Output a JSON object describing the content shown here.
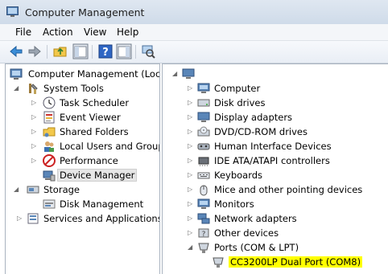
{
  "window": {
    "title": "Computer Management"
  },
  "menu": [
    {
      "label": "File"
    },
    {
      "label": "Action"
    },
    {
      "label": "View"
    },
    {
      "label": "Help"
    }
  ],
  "toolbar": [
    "back-arrow-icon",
    "forward-arrow-icon",
    "up-folder-icon",
    "show-hide-tree-icon",
    "help-icon",
    "properties-icon",
    "scan-hardware-icon"
  ],
  "left_tree": [
    {
      "label": "Computer Management (Local",
      "icon": "computer-management-icon",
      "expanded": true
    },
    {
      "label": "System Tools",
      "icon": "system-tools-icon",
      "expanded": true
    },
    {
      "label": "Task Scheduler",
      "icon": "clock-icon"
    },
    {
      "label": "Event Viewer",
      "icon": "event-viewer-icon"
    },
    {
      "label": "Shared Folders",
      "icon": "shared-folder-icon"
    },
    {
      "label": "Local Users and Groups",
      "icon": "users-icon"
    },
    {
      "label": "Performance",
      "icon": "performance-icon"
    },
    {
      "label": "Device Manager",
      "icon": "device-manager-icon",
      "selected": true
    },
    {
      "label": "Storage",
      "icon": "storage-icon",
      "expanded": true
    },
    {
      "label": "Disk Management",
      "icon": "disk-management-icon"
    },
    {
      "label": "Services and Applications",
      "icon": "services-icon"
    }
  ],
  "right_tree": {
    "root_label": "",
    "items": [
      {
        "label": "Computer",
        "icon": "monitor-icon"
      },
      {
        "label": "Disk drives",
        "icon": "disk-drive-icon"
      },
      {
        "label": "Display adapters",
        "icon": "display-adapter-icon"
      },
      {
        "label": "DVD/CD-ROM drives",
        "icon": "dvd-icon"
      },
      {
        "label": "Human Interface Devices",
        "icon": "hid-icon"
      },
      {
        "label": "IDE ATA/ATAPI controllers",
        "icon": "ide-controller-icon"
      },
      {
        "label": "Keyboards",
        "icon": "keyboard-icon"
      },
      {
        "label": "Mice and other pointing devices",
        "icon": "mouse-icon"
      },
      {
        "label": "Monitors",
        "icon": "monitor-icon"
      },
      {
        "label": "Network adapters",
        "icon": "network-adapter-icon"
      },
      {
        "label": "Other devices",
        "icon": "other-devices-icon"
      },
      {
        "label": "Ports (COM & LPT)",
        "icon": "port-icon",
        "expanded": true
      },
      {
        "label": "CC3200LP Dual Port (COM8)",
        "icon": "port-icon",
        "child": true,
        "highlight": true
      }
    ]
  },
  "colors": {
    "titlebar": "#dbe5f1",
    "highlight": "#ffff00",
    "pane_border": "#a9b3c0"
  }
}
